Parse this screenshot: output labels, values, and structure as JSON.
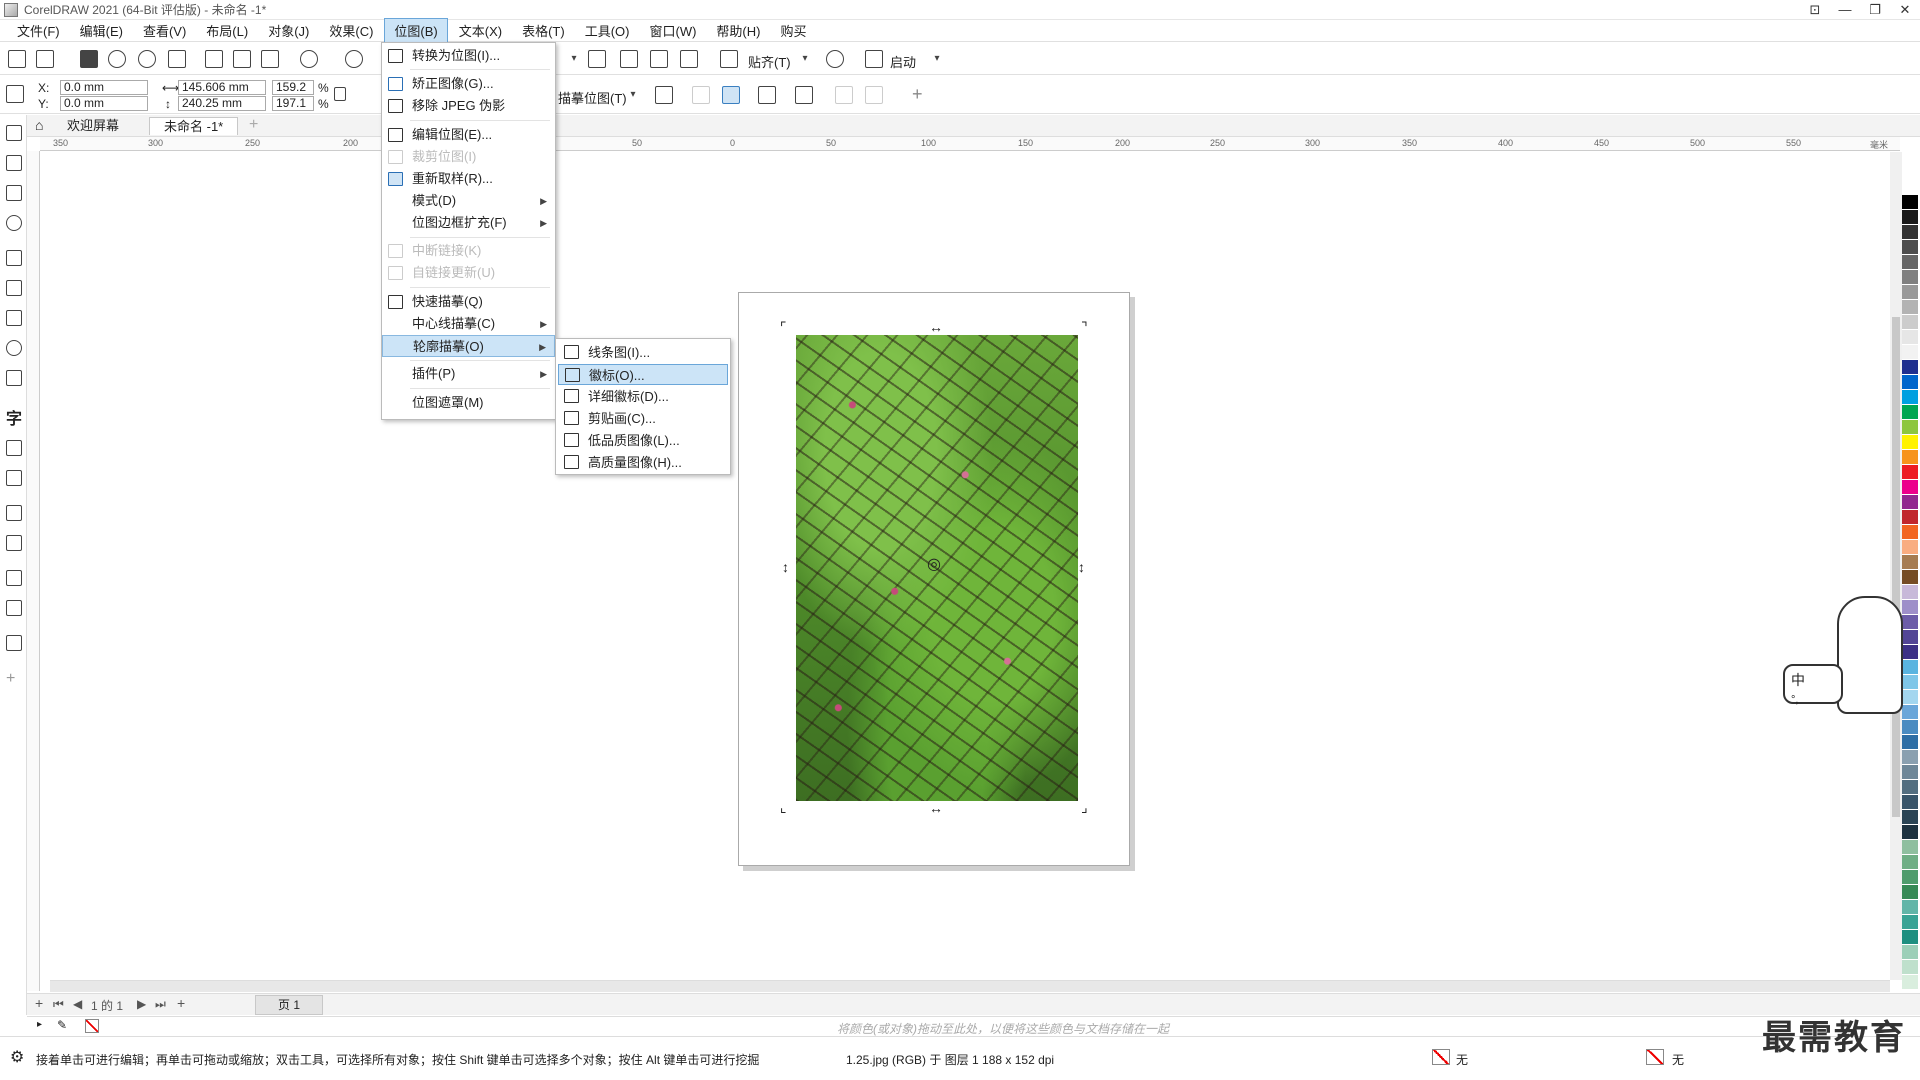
{
  "window": {
    "title": "CorelDRAW 2021 (64-Bit 评估版) - 未命名 -1*",
    "controls": [
      "⊡",
      "—",
      "❐",
      "✕"
    ]
  },
  "menubar": [
    {
      "label": "文件(F)"
    },
    {
      "label": "编辑(E)"
    },
    {
      "label": "查看(V)"
    },
    {
      "label": "布局(L)"
    },
    {
      "label": "对象(J)"
    },
    {
      "label": "效果(C)"
    },
    {
      "label": "位图(B)",
      "active": true
    },
    {
      "label": "文本(X)"
    },
    {
      "label": "表格(T)"
    },
    {
      "label": "工具(O)"
    },
    {
      "label": "窗口(W)"
    },
    {
      "label": "帮助(H)"
    },
    {
      "label": "购买"
    }
  ],
  "toolbar": {
    "snap_label": "贴齐(T)",
    "launch_label": "启动",
    "trace_label": "描摹位图(T)"
  },
  "propbar": {
    "x_label": "X:",
    "y_label": "Y:",
    "x_value": "0.0 mm",
    "y_value": "0.0 mm",
    "width_value": "145.606 mm",
    "height_value": "240.25 mm",
    "scale_w": "159.2",
    "scale_h": "197.1",
    "percent": "%"
  },
  "doc_tabs": [
    {
      "label": "欢迎屏幕"
    },
    {
      "label": "未命名 -1*"
    }
  ],
  "ruler_h_labels": [
    "350",
    "300",
    "250",
    "200",
    "50",
    "0",
    "50",
    "100",
    "150",
    "200",
    "250",
    "300",
    "350",
    "400",
    "450",
    "500",
    "550"
  ],
  "ruler_unit": "毫米",
  "bitmap_menu": [
    {
      "label": "转换为位图(I)...",
      "icon": "convert-bitmap-icon"
    },
    {
      "label": "矫正图像(G)...",
      "icon": "straighten-icon"
    },
    {
      "label": "移除 JPEG 伪影",
      "icon": "jpeg-artifact-icon"
    },
    {
      "label": "编辑位图(E)...",
      "icon": "edit-bitmap-icon"
    },
    {
      "label": "裁剪位图(I)",
      "icon": "crop-bitmap-icon",
      "disabled": true
    },
    {
      "label": "重新取样(R)...",
      "icon": "resample-icon"
    },
    {
      "label": "模式(D)",
      "submenu": true
    },
    {
      "label": "位图边框扩充(F)",
      "submenu": true
    },
    {
      "label": "中断链接(K)",
      "icon": "break-link-icon",
      "disabled": true
    },
    {
      "label": "自链接更新(U)",
      "icon": "update-link-icon",
      "disabled": true
    },
    {
      "label": "快速描摹(Q)",
      "icon": "quick-trace-icon"
    },
    {
      "label": "中心线描摹(C)",
      "submenu": true
    },
    {
      "label": "轮廓描摹(O)",
      "submenu": true,
      "highlight": true
    },
    {
      "label": "插件(P)",
      "submenu": true
    },
    {
      "label": "位图遮罩(M)"
    }
  ],
  "outline_submenu": [
    {
      "label": "线条图(I)...",
      "icon": "line-art-icon"
    },
    {
      "label": "徽标(O)...",
      "icon": "logo-icon",
      "highlight": true
    },
    {
      "label": "详细徽标(D)...",
      "icon": "detailed-logo-icon"
    },
    {
      "label": "剪贴画(C)...",
      "icon": "clipart-icon"
    },
    {
      "label": "低品质图像(L)...",
      "icon": "low-quality-image-icon"
    },
    {
      "label": "高质量图像(H)...",
      "icon": "high-quality-image-icon"
    }
  ],
  "page_nav": {
    "page_info": "1 的 1",
    "page_tab": "页 1"
  },
  "colorbar_hint": "将颜色(或对象)拖动至此处，以便将这些颜色与文档存储在一起",
  "status": {
    "hint": "接着单击可进行编辑；再单击可拖动或缩放；双击工具，可选择所有对象；按住 Shift 键单击可选择多个对象；按住 Alt 键单击可进行挖掘",
    "object_info": "1.25.jpg (RGB) 于 图层 1 188 x 152 dpi",
    "fill_label": "无",
    "outline_label": "无"
  },
  "ime": {
    "text1": "中",
    "text2": "°,"
  },
  "watermark": "最需教育",
  "palette_colors": [
    "#ffffff",
    "#000000",
    "#1a1a1a",
    "#333333",
    "#4d4d4d",
    "#666666",
    "#808080",
    "#999999",
    "#b3b3b3",
    "#cccccc",
    "#e6e6e6",
    "#f2f2f2",
    "#1f2f8f",
    "#0066cc",
    "#00a0e0",
    "#00a651",
    "#8dc63f",
    "#fff200",
    "#f7941d",
    "#ed1c24",
    "#ec008c",
    "#92278f",
    "#c1272d",
    "#f26522",
    "#f9ad81",
    "#a67c52",
    "#754c24",
    "#c8b9d9",
    "#9e8fc9",
    "#6c5ca8",
    "#534596",
    "#3d3086",
    "#5ab4e0",
    "#7fc6e8",
    "#a3d6ef",
    "#6aa6d9",
    "#4a8bc1",
    "#2e6ea5",
    "#8aa0b0",
    "#6e8798",
    "#536e80",
    "#39556a",
    "#2a4455",
    "#1d3240",
    "#8fbf9f",
    "#6fae85",
    "#4f9c6c",
    "#378a56",
    "#62b5a8",
    "#3aa395",
    "#1e8f80",
    "#9ccfb8",
    "#bfe0cc",
    "#d9eede"
  ]
}
